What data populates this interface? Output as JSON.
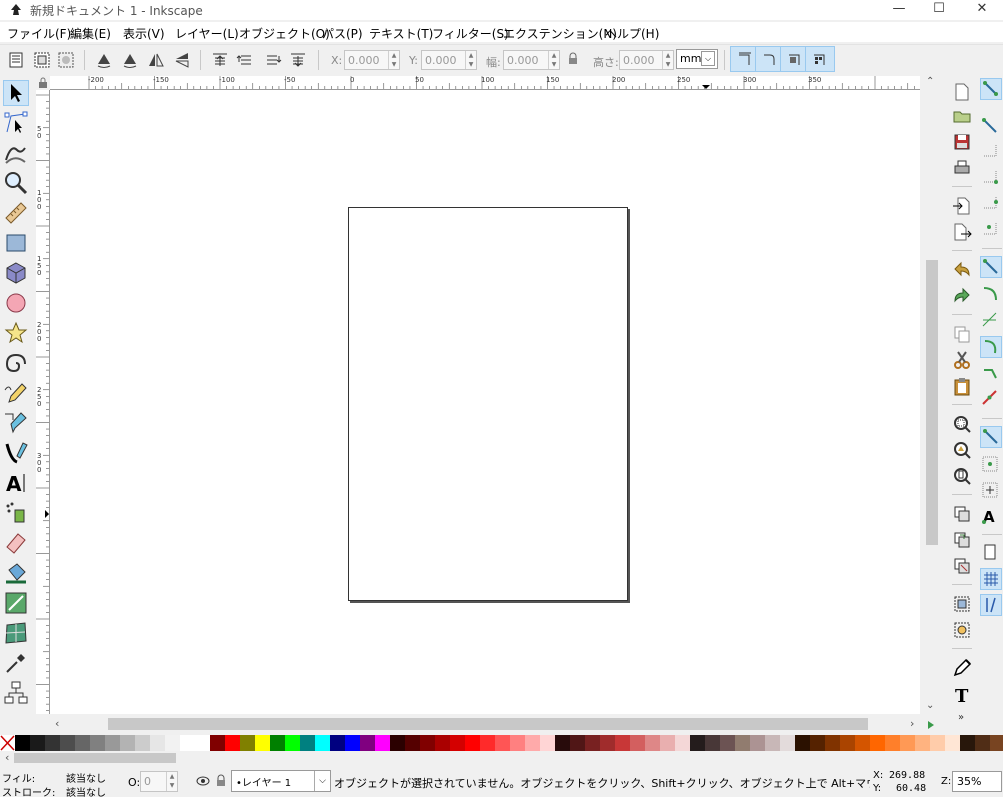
{
  "window": {
    "title": "新規ドキュメント 1 - Inkscape",
    "minimize": "—",
    "maximize": "☐",
    "close": "✕"
  },
  "menu": [
    "ファイル(F)",
    "編集(E)",
    "表示(V)",
    "レイヤー(L)",
    "オブジェクト(O)",
    "パス(P)",
    "テキスト(T)",
    "フィルター(S)",
    "エクステンション(N)",
    "ヘルプ(H)"
  ],
  "toolbar": {
    "x_label": "X:",
    "x_value": "0.000",
    "y_label": "Y:",
    "y_value": "0.000",
    "w_label": "幅:",
    "w_value": "0.000",
    "h_label": "高さ:",
    "h_value": "0.000",
    "unit": "mm"
  },
  "hruler_labels": [
    "-200",
    "-150",
    "-100",
    "-50",
    "0",
    "50",
    "100",
    "150",
    "200",
    "250",
    "300",
    "350"
  ],
  "vruler_labels": [
    "5 0",
    "1 0 0",
    "1 5 0",
    "2 0 0",
    "2 5 0",
    "3 0 0"
  ],
  "palette": [
    "#000000",
    "#1a1a1a",
    "#333333",
    "#4d4d4d",
    "#666666",
    "#808080",
    "#999999",
    "#b3b3b3",
    "#cccccc",
    "#e6e6e6",
    "#f2f2f2",
    "#ffffff",
    "#ffffff",
    "#800000",
    "#ff0000",
    "#808000",
    "#ffff00",
    "#008000",
    "#00ff00",
    "#008080",
    "#00ffff",
    "#000080",
    "#0000ff",
    "#800080",
    "#ff00ff",
    "#2b0000",
    "#550000",
    "#800000",
    "#aa0000",
    "#d40000",
    "#ff0000",
    "#ff2a2a",
    "#ff5555",
    "#ff8080",
    "#ffaaaa",
    "#ffd5d5",
    "#280b0b",
    "#501616",
    "#782121",
    "#a02c2c",
    "#c83737",
    "#d35f5f",
    "#de8787",
    "#e9afaf",
    "#f4d7d7",
    "#241c1c",
    "#483737",
    "#6c5353",
    "#917c6f",
    "#ac9393",
    "#c8b7b7",
    "#e3dbdb",
    "#2b1100",
    "#552200",
    "#803300",
    "#aa4400",
    "#d45500",
    "#ff6600",
    "#ff7f2a",
    "#ff9955",
    "#ffb380",
    "#ffccaa",
    "#ffe6d5",
    "#28170b",
    "#502d16",
    "#784421",
    "#a05a2c",
    "#c87137",
    "#d38d5f"
  ],
  "status": {
    "fill_label": "フィル:",
    "fill_value": "該当なし",
    "stroke_label": "ストローク:",
    "stroke_value": "該当なし",
    "opacity_label": "O:",
    "opacity_value": "0",
    "layer": "•レイヤー 1",
    "message": "オブジェクトが選択されていません。オブジェクトをクリック、Shift+クリック、オブジェクト上で Alt+マウススクロール、ま...",
    "x_label": "X:",
    "x_value": "269.88",
    "y_label": "Y:",
    "y_value": "60.48",
    "zoom_label": "Z:",
    "zoom_value": "35%"
  }
}
